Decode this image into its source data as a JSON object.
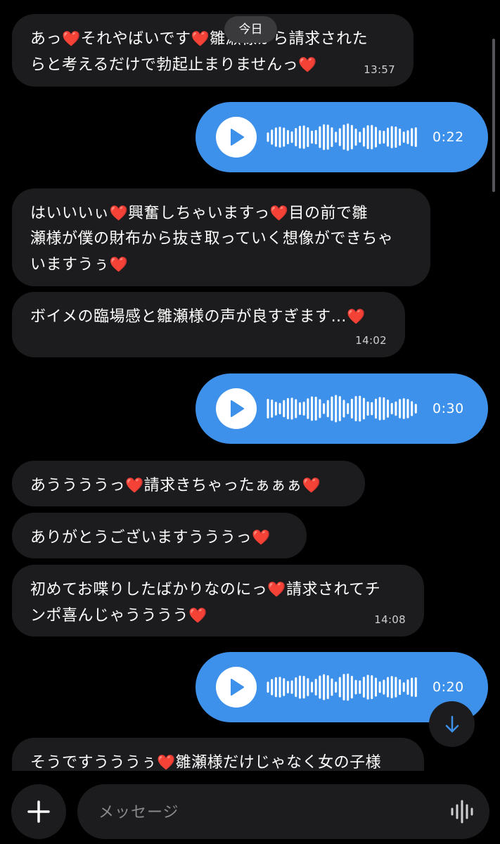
{
  "date_separator": "今日",
  "messages": [
    {
      "type": "text",
      "lines": [
        "あっ",
        "それやばいです",
        "雛瀬様から請求された",
        "らと考えるだけで勃起止まりません",
        "っ"
      ],
      "time": "13:57"
    },
    {
      "type": "voice",
      "duration": "0:22"
    },
    {
      "type": "text",
      "time": ""
    },
    {
      "type": "text",
      "time": "14:02"
    },
    {
      "type": "voice",
      "duration": "0:30"
    },
    {
      "type": "text",
      "time": ""
    },
    {
      "type": "text",
      "time": ""
    },
    {
      "type": "text",
      "time": "14:08"
    },
    {
      "type": "voice",
      "duration": "0:20"
    },
    {
      "type": "text",
      "time": ""
    }
  ],
  "text": {
    "m1a": "あっ",
    "m1b": "それやばいです",
    "m1c": "雛瀬様から請求された",
    "m1d": "らと考えるだけで勃起止まりませんっ",
    "m3a": "はいいいぃ",
    "m3b": "興奮しちゃいますっ",
    "m3c": "目の前で雛",
    "m3d": "瀬様が僕の財布から抜き取っていく想像ができちゃ",
    "m3e": "いますうぅ",
    "m4a": "ボイメの臨場感と雛瀬様の声が良すぎます…",
    "m6a": "あううううっ",
    "m6b": "請求きちゃったぁぁぁ",
    "m7a": "ありがとうございますうううっ",
    "m8a": "初めてお喋りしたばかりなのにっ",
    "m8b": "請求されてチ",
    "m8c": "ンポ喜んじゃうううう",
    "m10a": "そうですうううぅ",
    "m10b": "雛瀬様だけじゃなく女の子様"
  },
  "times": {
    "t1": "13:57",
    "t4": "14:02",
    "t8": "14:08"
  },
  "voice": {
    "v1": "0:22",
    "v2": "0:30",
    "v3": "0:20"
  },
  "input": {
    "placeholder": "メッセージ"
  },
  "icons": {
    "heart": "heart-emoji",
    "play": "play-icon",
    "plus": "plus-icon",
    "mic": "voice-waveform-icon",
    "down": "arrow-down-icon"
  },
  "colors": {
    "background": "#000000",
    "bubble_in": "#1c1c1e",
    "bubble_out": "#3d91ea",
    "heart": "#e5252a",
    "text_secondary": "#8a8a8e"
  }
}
